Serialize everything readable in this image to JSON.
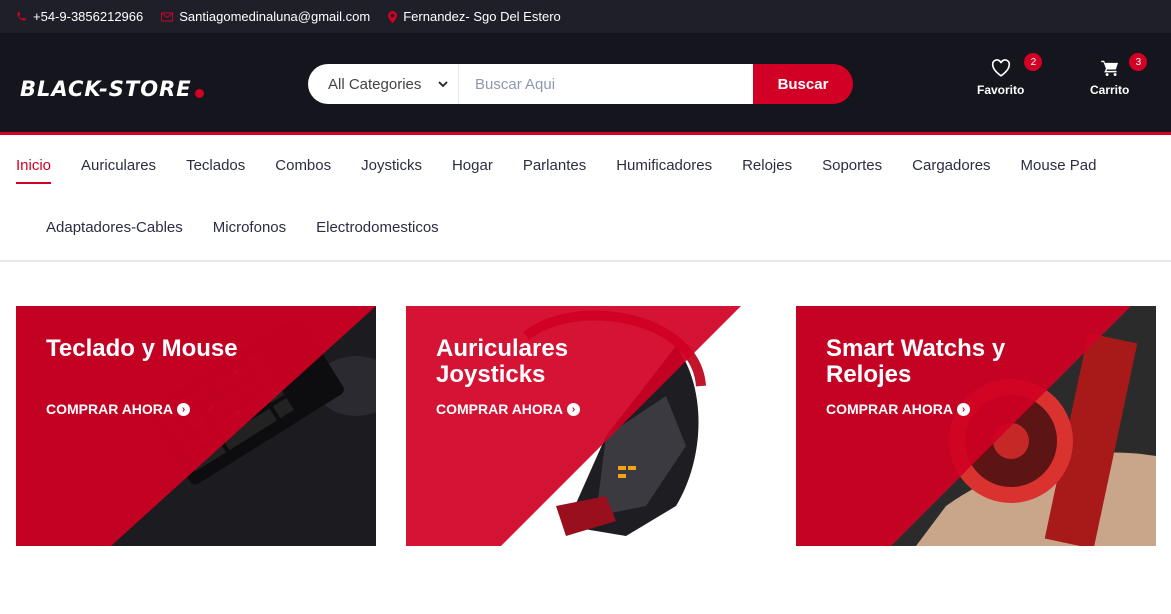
{
  "topbar": {
    "phone": "+54-9-3856212966",
    "email": "Santiagomedinaluna@gmail.com",
    "location": "Fernandez- Sgo Del Estero"
  },
  "header": {
    "logo_text": "BLACK-STORE",
    "search": {
      "category_selected": "All Categories",
      "placeholder": "Buscar Aqui",
      "button_label": "Buscar"
    },
    "favorites": {
      "label": "Favorito",
      "count": "2",
      "icon": "heart-icon"
    },
    "cart": {
      "label": "Carrito",
      "count": "3",
      "icon": "cart-icon"
    }
  },
  "nav": {
    "items": [
      "Inicio",
      "Auriculares",
      "Teclados",
      "Combos",
      "Joysticks",
      "Hogar",
      "Parlantes",
      "Humificadores",
      "Relojes",
      "Soportes",
      "Cargadores",
      "Mouse Pad",
      "Adaptadores-Cables",
      "Microfonos",
      "Electrodomesticos"
    ],
    "active": "Inicio"
  },
  "promos": [
    {
      "title": "Teclado y Mouse",
      "cta": "COMPRAR AHORA"
    },
    {
      "title": "Auriculares Joysticks",
      "cta": "COMPRAR AHORA"
    },
    {
      "title": "Smart Watchs y Relojes",
      "cta": "COMPRAR AHORA"
    }
  ],
  "colors": {
    "accent": "#D10024",
    "header_bg": "#15161D",
    "topbar_bg": "#1E1F29"
  }
}
